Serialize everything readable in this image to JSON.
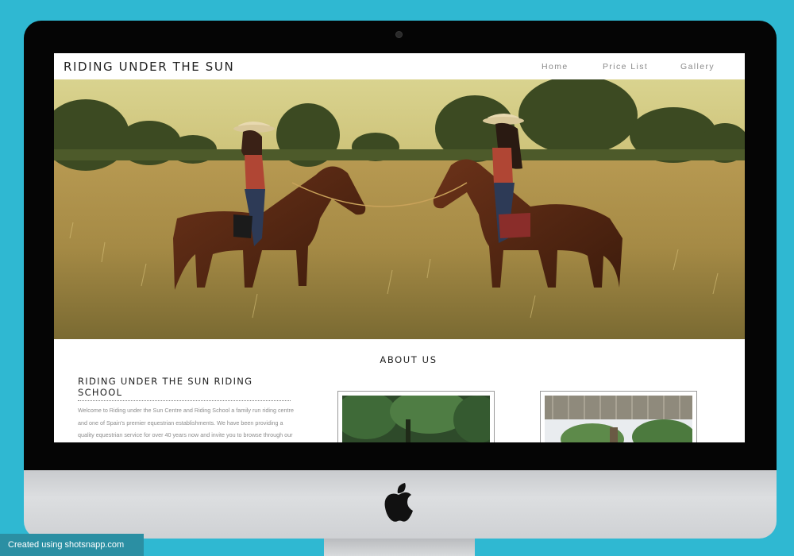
{
  "site": {
    "title": "RIDING UNDER THE SUN",
    "nav": [
      {
        "label": "Home"
      },
      {
        "label": "Price List"
      },
      {
        "label": "Gallery"
      }
    ]
  },
  "hero": {
    "icon": "hero-photo-two-women-on-horses-in-field"
  },
  "about": {
    "heading": "ABOUT US",
    "school_heading": "RIDING UNDER THE SUN RIDING SCHOOL",
    "body": "Welcome to Riding under the Sun Centre and Riding School a family run riding centre and one of Spain's premier equestrian establishments. We have been providing a quality equestrian service for over 40 years now and invite you to browse through our site to discover the many facilities and services we offer."
  },
  "gallery_cards": [
    {
      "icon": "trees-photo"
    },
    {
      "icon": "stable-roof-photo"
    }
  ],
  "device": {
    "apple_icon": "apple-logo-icon"
  },
  "watermark": {
    "text": "Created using shotsnapp.com"
  },
  "colors": {
    "background": "#2fb8d2",
    "bezel": "#050505",
    "chin": "#d6d8db",
    "badge": "#2b8fa3"
  }
}
